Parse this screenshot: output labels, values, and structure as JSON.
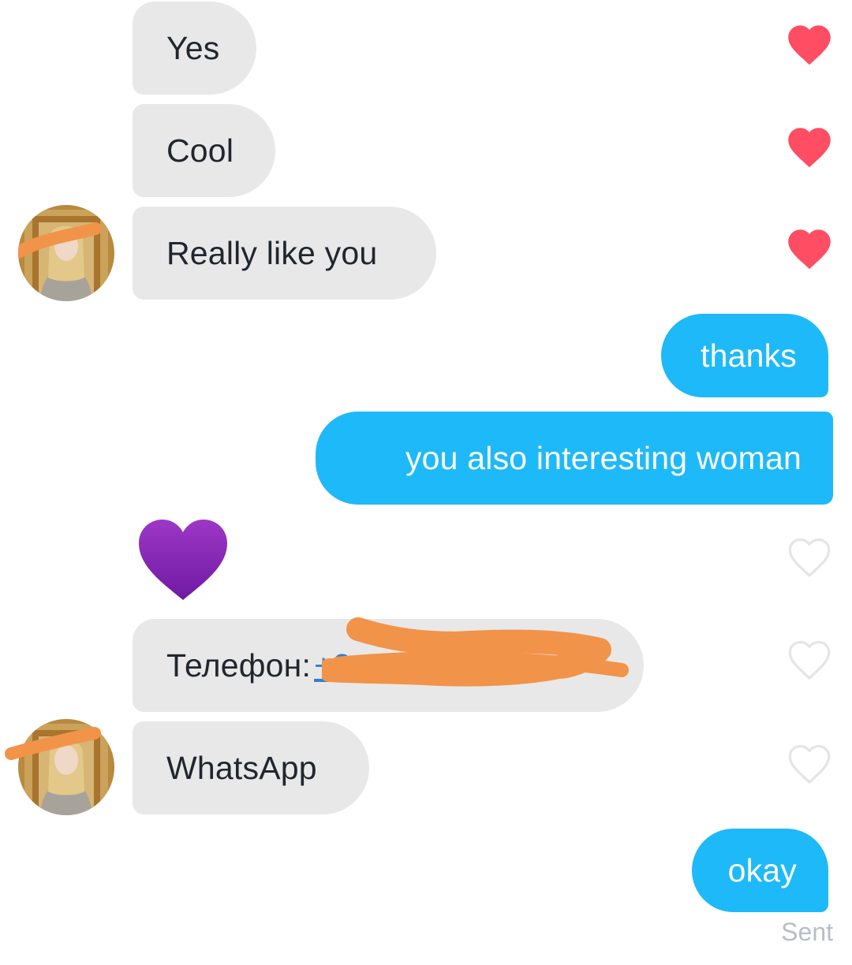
{
  "messages": {
    "m1": {
      "text": "Yes",
      "liked": true
    },
    "m2": {
      "text": "Cool",
      "liked": true
    },
    "m3": {
      "text": "Really like you",
      "liked": true
    },
    "m4": {
      "text": "thanks"
    },
    "m5": {
      "text": "you also interesting woman"
    },
    "m6": {
      "emoji": "purple-heart-emoji",
      "liked": false
    },
    "m7": {
      "label": "Телефон:",
      "link_text": "+3",
      "liked": false
    },
    "m8": {
      "text": "WhatsApp",
      "liked": false
    },
    "m9": {
      "text": "okay"
    }
  },
  "status": {
    "sent_label": "Sent"
  },
  "colors": {
    "received_bubble": "#e8e8e8",
    "sent_bubble": "#1eb9f8",
    "like_heart": "#ff4d63",
    "unliked_heart_outline": "#e5e5e5",
    "redaction": "#f2934a",
    "link": "#2f7fd0"
  },
  "icons": {
    "like": "heart-icon",
    "unlike": "heart-outline-icon",
    "avatar": "avatar"
  }
}
